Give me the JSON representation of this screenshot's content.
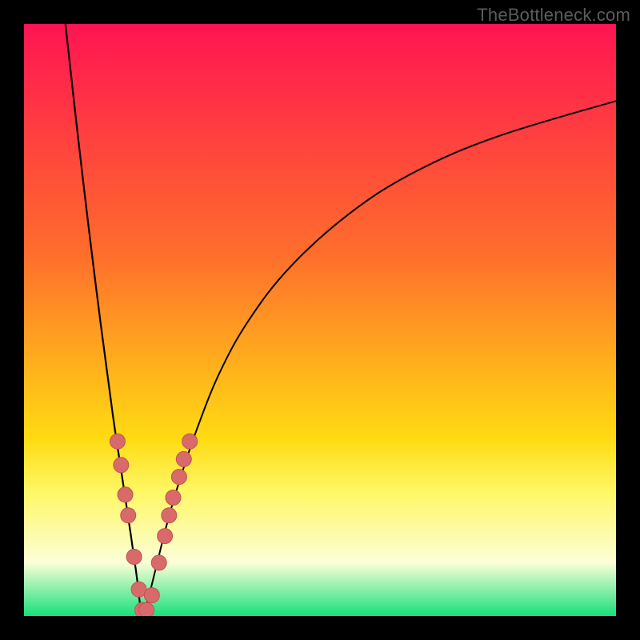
{
  "watermark": "TheBottleneck.com",
  "colors": {
    "frame": "#000000",
    "curve": "#000000",
    "marker_fill": "#d86a6a",
    "marker_stroke": "#c65151",
    "grad_top": "#ff1452",
    "grad_mid1": "#ff6e2c",
    "grad_mid2": "#ffdb12",
    "grad_band_top": "#fff765",
    "grad_band_mid": "#fbffd7",
    "grad_bottom": "#18e07b"
  },
  "chart_data": {
    "type": "line",
    "title": "",
    "xlabel": "",
    "ylabel": "",
    "xlim": [
      0,
      100
    ],
    "ylim": [
      0,
      100
    ],
    "x_optimum": 20,
    "curve_left": {
      "x": [
        7,
        9,
        11,
        13,
        15,
        16.5,
        18,
        19,
        19.6,
        20
      ],
      "y": [
        100,
        82,
        65,
        49,
        34,
        24,
        14,
        7,
        2,
        0
      ]
    },
    "curve_right": {
      "x": [
        20,
        21,
        22.5,
        24,
        26,
        29,
        33,
        38,
        45,
        55,
        66,
        80,
        100
      ],
      "y": [
        0,
        3,
        9,
        15,
        22,
        31,
        41,
        50,
        59,
        68,
        75,
        81,
        87
      ]
    },
    "markers": [
      {
        "x": 15.8,
        "y": 29.5
      },
      {
        "x": 16.4,
        "y": 25.5
      },
      {
        "x": 17.1,
        "y": 20.5
      },
      {
        "x": 17.6,
        "y": 17.0
      },
      {
        "x": 18.6,
        "y": 10.0
      },
      {
        "x": 19.4,
        "y": 4.5
      },
      {
        "x": 20.0,
        "y": 1.0
      },
      {
        "x": 20.7,
        "y": 1.0
      },
      {
        "x": 21.6,
        "y": 3.5
      },
      {
        "x": 22.8,
        "y": 9.0
      },
      {
        "x": 23.8,
        "y": 13.5
      },
      {
        "x": 24.5,
        "y": 17.0
      },
      {
        "x": 25.2,
        "y": 20.0
      },
      {
        "x": 26.2,
        "y": 23.5
      },
      {
        "x": 27.0,
        "y": 26.5
      },
      {
        "x": 28.0,
        "y": 29.5
      }
    ]
  }
}
